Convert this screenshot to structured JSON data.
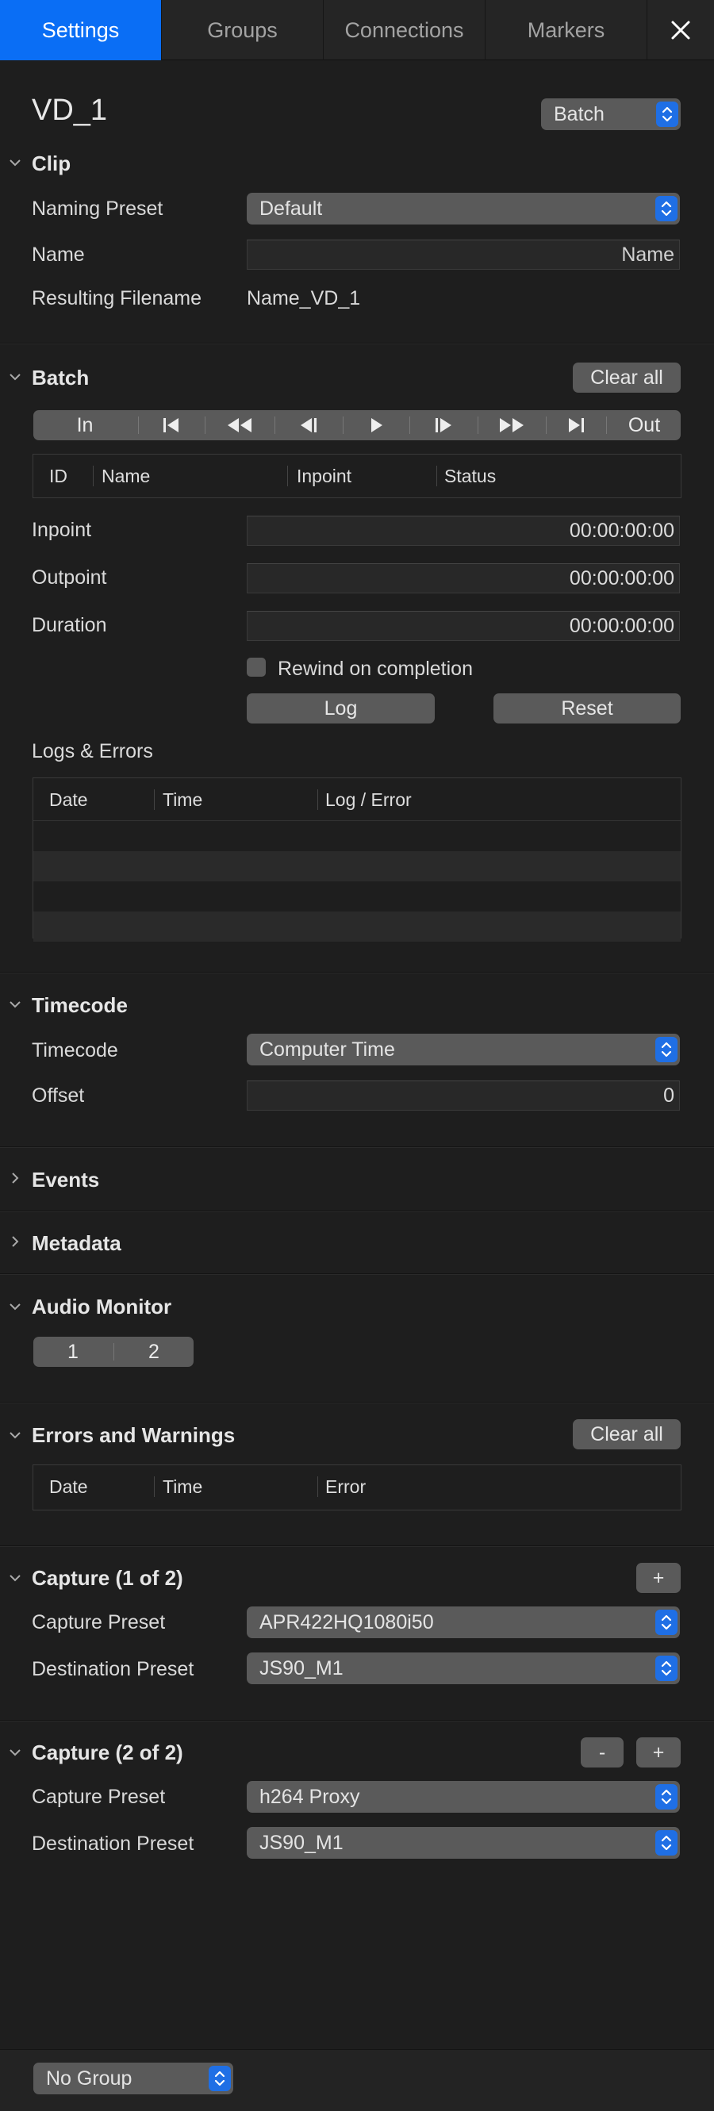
{
  "tabs": [
    "Settings",
    "Groups",
    "Connections",
    "Markers"
  ],
  "header": {
    "title": "VD_1",
    "mode_select": "Batch"
  },
  "clip": {
    "title": "Clip",
    "naming_preset_label": "Naming Preset",
    "naming_preset_value": "Default",
    "name_label": "Name",
    "name_placeholder": "Name",
    "resulting_label": "Resulting Filename",
    "resulting_value": "Name_VD_1"
  },
  "batch": {
    "title": "Batch",
    "clear_label": "Clear all",
    "transport_in": "In",
    "transport_out": "Out",
    "columns": [
      "ID",
      "Name",
      "Inpoint",
      "Status"
    ],
    "inpoint_label": "Inpoint",
    "inpoint_value": "00:00:00:00",
    "outpoint_label": "Outpoint",
    "outpoint_value": "00:00:00:00",
    "duration_label": "Duration",
    "duration_value": "00:00:00:00",
    "rewind_label": "Rewind on completion",
    "log_label": "Log",
    "reset_label": "Reset",
    "logs_title": "Logs & Errors",
    "logs_columns": [
      "Date",
      "Time",
      "Log / Error"
    ]
  },
  "timecode": {
    "title": "Timecode",
    "timecode_label": "Timecode",
    "timecode_value": "Computer Time",
    "offset_label": "Offset",
    "offset_value": "0"
  },
  "events": {
    "title": "Events"
  },
  "metadata": {
    "title": "Metadata"
  },
  "audio": {
    "title": "Audio Monitor",
    "channels": [
      "1",
      "2"
    ]
  },
  "errors": {
    "title": "Errors and Warnings",
    "clear_label": "Clear all",
    "columns": [
      "Date",
      "Time",
      "Error"
    ]
  },
  "capture1": {
    "title": "Capture (1 of 2)",
    "add_label": "+",
    "capture_label": "Capture Preset",
    "capture_value": "APR422HQ1080i50",
    "dest_label": "Destination Preset",
    "dest_value": "JS90_M1"
  },
  "capture2": {
    "title": "Capture (2 of 2)",
    "remove_label": "-",
    "add_label": "+",
    "capture_label": "Capture Preset",
    "capture_value": "h264 Proxy",
    "dest_label": "Destination Preset",
    "dest_value": "JS90_M1"
  },
  "footer": {
    "group_select": "No Group"
  },
  "colors": {
    "accent": "#0a6ef5",
    "background": "#1e1e1e",
    "control": "#5a5a5a"
  }
}
